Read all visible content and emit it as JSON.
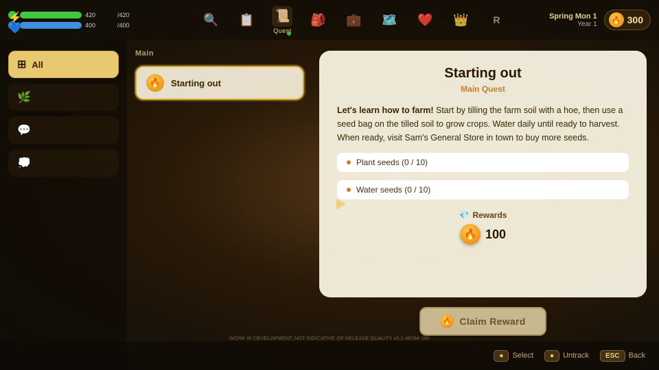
{
  "topbar": {
    "stats": [
      {
        "icon": "⚡",
        "color": "#70e870",
        "fill_color": "#40c840",
        "fill_pct": 100,
        "current": 420,
        "max": 420
      },
      {
        "icon": "💙",
        "color": "#60b0ff",
        "fill_color": "#4090e0",
        "fill_pct": 100,
        "current": 400,
        "max": 400
      }
    ],
    "nav_items": [
      {
        "icon": "🔍",
        "label": "",
        "active": false,
        "dot": false
      },
      {
        "icon": "📋",
        "label": "",
        "active": false,
        "dot": false
      },
      {
        "icon": "📜",
        "label": "Quest",
        "active": true,
        "dot": true
      },
      {
        "icon": "🎒",
        "label": "",
        "active": false,
        "dot": false
      },
      {
        "icon": "💼",
        "label": "",
        "active": false,
        "dot": false
      },
      {
        "icon": "🗺️",
        "label": "",
        "active": false,
        "dot": false
      },
      {
        "icon": "❤️",
        "label": "",
        "active": false,
        "dot": false
      },
      {
        "icon": "👑",
        "label": "",
        "active": false,
        "dot": false
      },
      {
        "icon": "R",
        "label": "",
        "active": false,
        "dot": false
      }
    ],
    "season": "Spring Mon 1",
    "year": "Year 1",
    "coin_icon": "🔥",
    "currency": "300"
  },
  "sidebar": {
    "items": [
      {
        "id": "all",
        "icon": "⊞",
        "label": "All",
        "active": true
      },
      {
        "id": "cat1",
        "icon": "🌿",
        "label": "",
        "active": false
      },
      {
        "id": "cat2",
        "icon": "💬",
        "label": "",
        "active": false
      },
      {
        "id": "cat3",
        "icon": "💭",
        "label": "",
        "active": false
      }
    ]
  },
  "quest_list": {
    "section_label": "Main",
    "quests": [
      {
        "id": "starting_out",
        "icon": "🔥",
        "title": "Starting out",
        "selected": true
      }
    ]
  },
  "quest_detail": {
    "title": "Starting out",
    "subtitle": "Main Quest",
    "description_bold": "Let's learn how to farm!",
    "description_rest": " Start by tilling the farm soil with a hoe, then use a seed bag on the tilled soil to grow crops. Water daily until ready to harvest. When ready, visit Sam's General Store in town to buy more seeds.",
    "objectives": [
      {
        "text": "Plant seeds (0 / 10)"
      },
      {
        "text": "Water seeds (0 / 10)"
      }
    ],
    "rewards_label": "Rewards",
    "rewards_icon": "🔥",
    "rewards_value": "100"
  },
  "claim_button": {
    "label": "Claim Reward",
    "icon": "🔥"
  },
  "bottom_actions": [
    {
      "key": "●",
      "label": "Select"
    },
    {
      "key": "●",
      "label": "Untrack"
    },
    {
      "key": "ESC",
      "label": "Back"
    }
  ],
  "dev_notice": "WORK IN DEVELOPMENT, NOT INDICATIVE OF RELEASE QUALITY v0.1-48784-180"
}
